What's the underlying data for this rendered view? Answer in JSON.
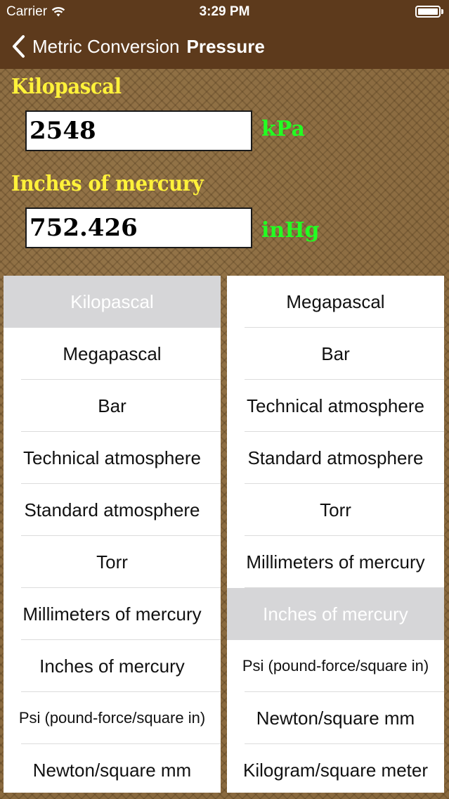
{
  "status_bar": {
    "carrier": "Carrier",
    "time": "3:29 PM",
    "icons": [
      "wifi-icon",
      "battery-icon"
    ]
  },
  "nav": {
    "back_label": "Metric Conversion",
    "title": "Pressure",
    "back_icon": "chevron-left-icon"
  },
  "converter": {
    "from": {
      "label": "Kilopascal",
      "value": "2548",
      "unit": "kPa"
    },
    "to": {
      "label": "Inches of mercury",
      "value": "752.426",
      "unit": "inHg"
    }
  },
  "left_list": {
    "selected_index": 0,
    "items": [
      "Kilopascal",
      "Megapascal",
      "Bar",
      "Technical atmosphere",
      "Standard atmosphere",
      "Torr",
      "Millimeters of mercury",
      "Inches of mercury",
      "Psi (pound-force/square in)",
      "Newton/square mm"
    ]
  },
  "right_list": {
    "selected_index": 6,
    "items": [
      "Megapascal",
      "Bar",
      "Technical atmosphere",
      "Standard atmosphere",
      "Torr",
      "Millimeters of mercury",
      "Inches of mercury",
      "Psi (pound-force/square in)",
      "Newton/square mm",
      "Kilogram/square meter"
    ]
  },
  "colors": {
    "nav_bg": "#5d3a1c",
    "label_yellow": "#fff23a",
    "unit_green": "#22ff22",
    "selected_row": "#d6d6d8"
  }
}
